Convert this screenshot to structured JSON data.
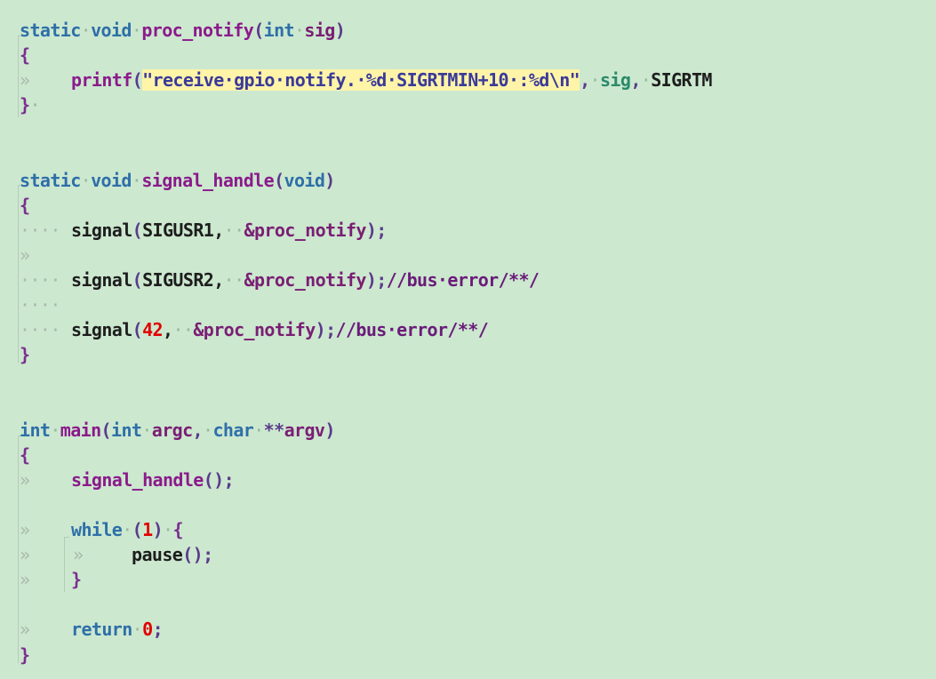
{
  "editor": {
    "background": "#cce8cf",
    "language": "c",
    "lines": [
      {
        "tokens": [
          [
            "kw",
            "static"
          ],
          [
            "dot",
            "·"
          ],
          [
            "ty",
            "void"
          ],
          [
            "dot",
            "·"
          ],
          [
            "fn",
            "proc_notify"
          ],
          [
            "pun",
            "("
          ],
          [
            "ty",
            "int"
          ],
          [
            "dot",
            "·"
          ],
          [
            "var",
            "sig"
          ],
          [
            "pun",
            ")"
          ]
        ]
      },
      {
        "tokens": [
          [
            "brace",
            "{"
          ]
        ]
      },
      {
        "indent": "tab",
        "tokens": [
          [
            "fn",
            "printf"
          ],
          [
            "pun",
            "("
          ],
          [
            "str",
            "\"receive·gpio·notify.·%d·SIGRTMIN+10·:%d\\n\""
          ],
          [
            "pun",
            ","
          ],
          [
            "dot",
            "·"
          ],
          [
            "sig",
            "sig"
          ],
          [
            "pun",
            ","
          ],
          [
            "dot",
            "·"
          ],
          [
            "txt",
            "SIGRTM"
          ]
        ]
      },
      {
        "tokens": [
          [
            "brace",
            "}"
          ],
          [
            "dot",
            "·"
          ]
        ]
      },
      {
        "tokens": []
      },
      {
        "tokens": []
      },
      {
        "tokens": [
          [
            "kw",
            "static"
          ],
          [
            "dot",
            "·"
          ],
          [
            "ty",
            "void"
          ],
          [
            "dot",
            "·"
          ],
          [
            "fn",
            "signal_handle"
          ],
          [
            "pun",
            "("
          ],
          [
            "ty",
            "void"
          ],
          [
            "pun",
            ")"
          ]
        ]
      },
      {
        "tokens": [
          [
            "brace",
            "{"
          ]
        ]
      },
      {
        "indent": "dots",
        "tokens": [
          [
            "txt",
            "signal"
          ],
          [
            "pun",
            "("
          ],
          [
            "txt",
            "SIGUSR1,"
          ],
          [
            "dot",
            "··"
          ],
          [
            "var",
            "&proc_notify"
          ],
          [
            "pun",
            ");"
          ]
        ]
      },
      {
        "indent": "tab",
        "tokens": []
      },
      {
        "indent": "dots",
        "tokens": [
          [
            "txt",
            "signal"
          ],
          [
            "pun",
            "("
          ],
          [
            "txt",
            "SIGUSR2,"
          ],
          [
            "dot",
            "··"
          ],
          [
            "var",
            "&proc_notify"
          ],
          [
            "pun",
            ");"
          ],
          [
            "cmt",
            "//bus·error/**/"
          ]
        ]
      },
      {
        "indent": "dots",
        "tokens": []
      },
      {
        "indent": "dots",
        "tokens": [
          [
            "txt",
            "signal"
          ],
          [
            "pun",
            "("
          ],
          [
            "num",
            "42"
          ],
          [
            "txt",
            ","
          ],
          [
            "dot",
            "··"
          ],
          [
            "var",
            "&proc_notify"
          ],
          [
            "pun",
            ");"
          ],
          [
            "cmt",
            "//bus·error/**/"
          ]
        ]
      },
      {
        "tokens": [
          [
            "brace",
            "}"
          ]
        ]
      },
      {
        "tokens": []
      },
      {
        "tokens": []
      },
      {
        "tokens": [
          [
            "ty",
            "int"
          ],
          [
            "dot",
            "·"
          ],
          [
            "fn",
            "main"
          ],
          [
            "pun",
            "("
          ],
          [
            "ty",
            "int"
          ],
          [
            "dot",
            "·"
          ],
          [
            "var",
            "argc"
          ],
          [
            "pun",
            ","
          ],
          [
            "dot",
            "·"
          ],
          [
            "ty",
            "char"
          ],
          [
            "dot",
            "·"
          ],
          [
            "pun",
            "**"
          ],
          [
            "var",
            "argv"
          ],
          [
            "pun",
            ")"
          ]
        ]
      },
      {
        "tokens": [
          [
            "brace",
            "{"
          ]
        ]
      },
      {
        "indent": "tab",
        "tokens": [
          [
            "fn",
            "signal_handle"
          ],
          [
            "pun",
            "();"
          ]
        ]
      },
      {
        "tokens": []
      },
      {
        "indent": "tab",
        "tokens": [
          [
            "kw",
            "while"
          ],
          [
            "dot",
            "·"
          ],
          [
            "pun",
            "("
          ],
          [
            "num",
            "1"
          ],
          [
            "pun",
            ")"
          ],
          [
            "dot",
            "·"
          ],
          [
            "brace",
            "{"
          ]
        ]
      },
      {
        "indent": "tab2",
        "tokens": [
          [
            "txt",
            "pause"
          ],
          [
            "pun",
            "();"
          ]
        ]
      },
      {
        "indent": "tab",
        "tokens": [
          [
            "brace",
            "}"
          ]
        ]
      },
      {
        "tokens": []
      },
      {
        "indent": "tab",
        "tokens": [
          [
            "kw",
            "return"
          ],
          [
            "dot",
            "·"
          ],
          [
            "num",
            "0"
          ],
          [
            "pun",
            ";"
          ]
        ]
      },
      {
        "tokens": [
          [
            "brace",
            "}"
          ]
        ]
      }
    ]
  }
}
